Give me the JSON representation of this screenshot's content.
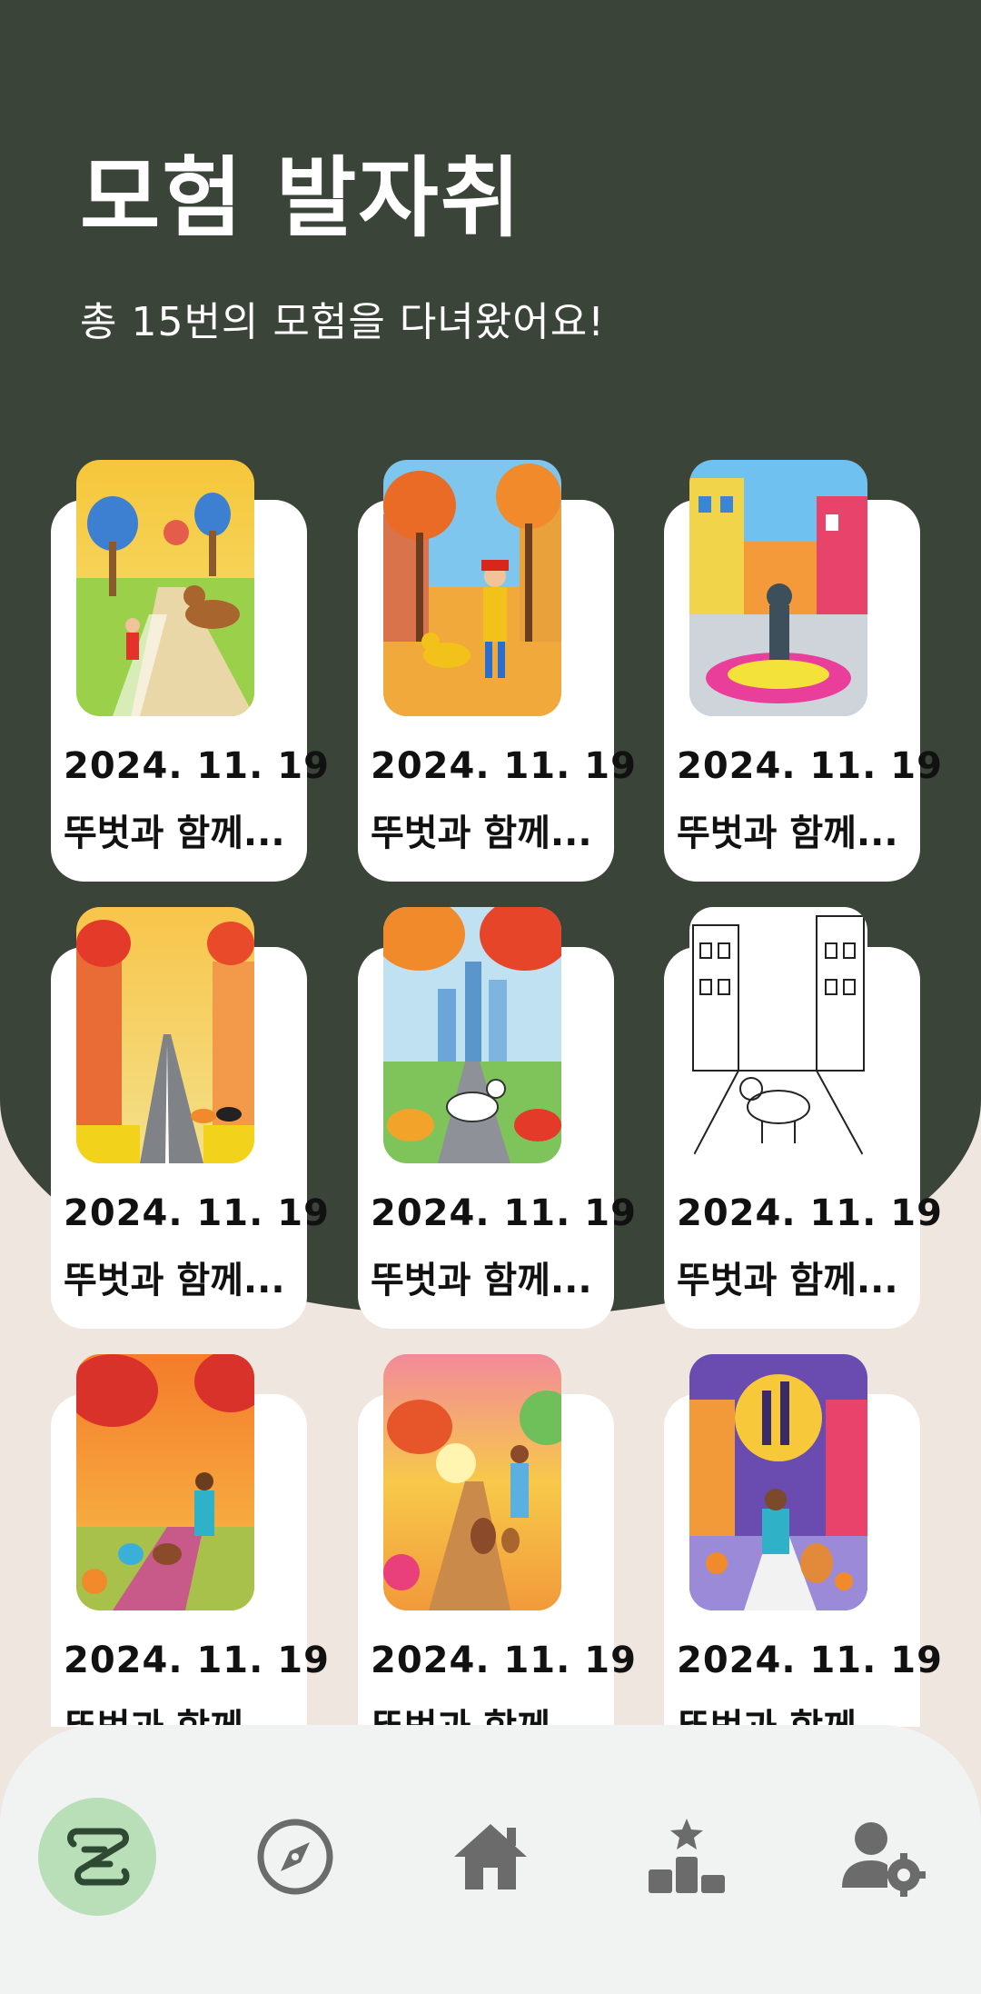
{
  "header": {
    "title": "모험 발자취",
    "subtitle": "총 15번의 모험을 다녀왔어요!"
  },
  "adventures": [
    {
      "date": "2024. 11. 19",
      "caption": "뚜벗과 함께..."
    },
    {
      "date": "2024. 11. 19",
      "caption": "뚜벗과 함께..."
    },
    {
      "date": "2024. 11. 19",
      "caption": "뚜벗과 함께..."
    },
    {
      "date": "2024. 11. 19",
      "caption": "뚜벗과 함께..."
    },
    {
      "date": "2024. 11. 19",
      "caption": "뚜벗과 함께..."
    },
    {
      "date": "2024. 11. 19",
      "caption": "뚜벗과 함께..."
    },
    {
      "date": "2024. 11. 19",
      "caption": "뚜벗과 함께"
    },
    {
      "date": "2024. 11. 19",
      "caption": "뚜벗과 함께"
    },
    {
      "date": "2024. 11. 19",
      "caption": "뚜벗과 함께"
    }
  ],
  "bottom_nav": {
    "items": [
      {
        "icon": "scroll-icon",
        "active": true
      },
      {
        "icon": "compass-icon",
        "active": false
      },
      {
        "icon": "home-icon",
        "active": false
      },
      {
        "icon": "leaderboard-icon",
        "active": false
      },
      {
        "icon": "user-settings-icon",
        "active": false
      }
    ]
  },
  "colors": {
    "header_bg": "#3b4439",
    "page_bg": "#efe7df",
    "card_bg": "#ffffff",
    "nav_bg": "#f1f2f2",
    "nav_active": "#b9dfb9",
    "icon_gray": "#6b6b6b",
    "icon_active": "#2f4a33"
  }
}
